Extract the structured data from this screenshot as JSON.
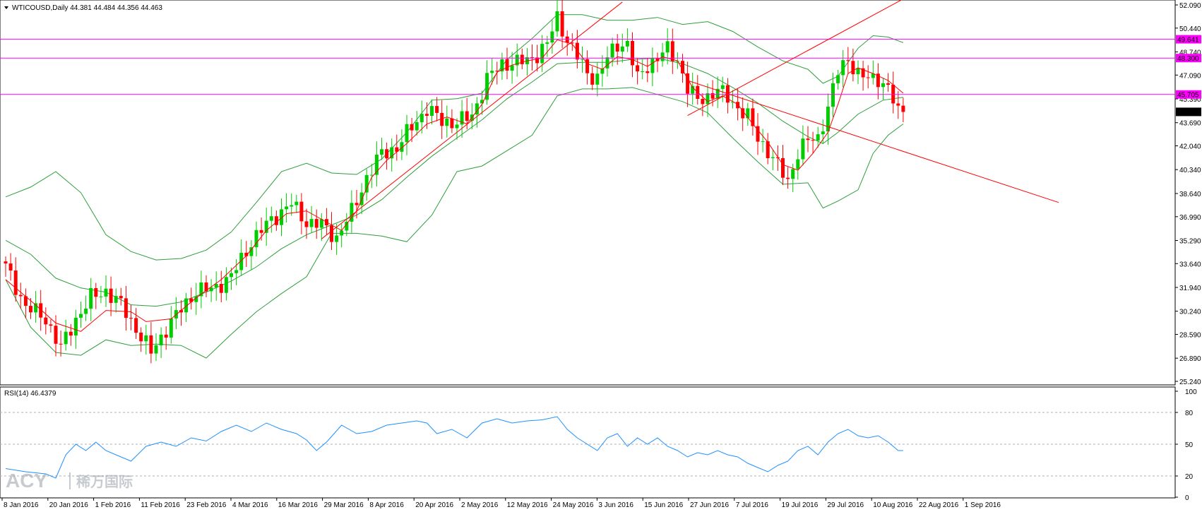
{
  "header": {
    "symbol_line": "WTICOUSD,Daily  44.381 44.484 44.356 44.463",
    "rsi_line": "RSI(14) 46.4379"
  },
  "logo": {
    "brand": "ACY",
    "cn": "稀万国际"
  },
  "chart_data": {
    "type": "candlestick",
    "price_axis": {
      "ticks": [
        "52.090",
        "50.440",
        "48.740",
        "47.090",
        "45.390",
        "43.690",
        "42.040",
        "40.340",
        "38.640",
        "36.990",
        "35.290",
        "33.640",
        "31.940",
        "30.240",
        "28.590",
        "26.890",
        "25.240"
      ],
      "ylim": [
        25.24,
        52.09
      ]
    },
    "horizontal_levels": [
      {
        "value": 49.641,
        "label": "49.641",
        "color": "#ff00ff"
      },
      {
        "value": 48.3,
        "label": "48.300",
        "color": "#ff00ff"
      },
      {
        "value": 45.705,
        "label": "45.705",
        "color": "#ff00ff"
      }
    ],
    "current_price": "44.463",
    "date_labels": [
      "8 Jan 2016",
      "20 Jan 2016",
      "1 Feb 2016",
      "11 Feb 2016",
      "23 Feb 2016",
      "4 Mar 2016",
      "16 Mar 2016",
      "29 Mar 2016",
      "8 Apr 2016",
      "20 Apr 2016",
      "2 May 2016",
      "12 May 2016",
      "24 May 2016",
      "3 Jun 2016",
      "15 Jun 2016",
      "27 Jun 2016",
      "7 Jul 2016",
      "19 Jul 2016",
      "29 Jul 2016",
      "10 Aug 2016",
      "22 Aug 2016",
      "1 Sep 2016"
    ],
    "close_path": [
      [
        0,
        33.4
      ],
      [
        4,
        30.6
      ],
      [
        8,
        29.7
      ],
      [
        11,
        27.6
      ],
      [
        14,
        29.7
      ],
      [
        17,
        31.2
      ],
      [
        20,
        31.7
      ],
      [
        23,
        30.7
      ],
      [
        26,
        29.0
      ],
      [
        29,
        27.3
      ],
      [
        32,
        29.0
      ],
      [
        35,
        30.4
      ],
      [
        38,
        31.7
      ],
      [
        41,
        31.8
      ],
      [
        45,
        32.7
      ],
      [
        49,
        35.2
      ],
      [
        53,
        36.8
      ],
      [
        57,
        37.9
      ],
      [
        60,
        36.6
      ],
      [
        63,
        36.4
      ],
      [
        66,
        35.5
      ],
      [
        69,
        37.3
      ],
      [
        72,
        39.8
      ],
      [
        75,
        41.5
      ],
      [
        78,
        41.9
      ],
      [
        81,
        43.4
      ],
      [
        84,
        44.7
      ],
      [
        87,
        43.8
      ],
      [
        90,
        43.7
      ],
      [
        93,
        44.2
      ],
      [
        96,
        46.8
      ],
      [
        99,
        47.9
      ],
      [
        102,
        48.0
      ],
      [
        104,
        48.1
      ],
      [
        106,
        48.6
      ],
      [
        108,
        49.3
      ],
      [
        110,
        51.2
      ],
      [
        112,
        49.6
      ],
      [
        114,
        48.4
      ],
      [
        116,
        47.2
      ],
      [
        118,
        46.9
      ],
      [
        120,
        48.3
      ],
      [
        122,
        49.3
      ],
      [
        124,
        49.3
      ],
      [
        126,
        46.8
      ],
      [
        128,
        47.8
      ],
      [
        130,
        48.3
      ],
      [
        132,
        48.9
      ],
      [
        134,
        48.2
      ],
      [
        136,
        46.1
      ],
      [
        138,
        45.3
      ],
      [
        140,
        45.6
      ],
      [
        142,
        46.0
      ],
      [
        144,
        45.5
      ],
      [
        146,
        44.8
      ],
      [
        148,
        44.1
      ],
      [
        150,
        42.6
      ],
      [
        152,
        41.7
      ],
      [
        154,
        40.6
      ],
      [
        156,
        39.5
      ],
      [
        158,
        41.6
      ],
      [
        160,
        42.4
      ],
      [
        162,
        42.6
      ],
      [
        164,
        44.8
      ],
      [
        166,
        47.3
      ],
      [
        168,
        48.3
      ],
      [
        170,
        47.1
      ],
      [
        172,
        46.8
      ],
      [
        174,
        46.9
      ],
      [
        176,
        46.1
      ],
      [
        178,
        44.4
      ],
      [
        179,
        44.46
      ]
    ],
    "last_day_index": 179,
    "ma_path": [
      [
        0,
        32.5
      ],
      [
        5,
        31.0
      ],
      [
        10,
        29.4
      ],
      [
        15,
        28.8
      ],
      [
        20,
        30.3
      ],
      [
        25,
        30.2
      ],
      [
        28,
        29.5
      ],
      [
        33,
        29.7
      ],
      [
        38,
        31.2
      ],
      [
        43,
        32.5
      ],
      [
        48,
        34.2
      ],
      [
        52,
        36.0
      ],
      [
        56,
        37.2
      ],
      [
        60,
        37.4
      ],
      [
        64,
        36.6
      ],
      [
        67,
        36.0
      ],
      [
        70,
        37.4
      ],
      [
        73,
        39.8
      ],
      [
        76,
        41.0
      ],
      [
        80,
        42.2
      ],
      [
        84,
        43.6
      ],
      [
        88,
        44.1
      ],
      [
        92,
        43.6
      ],
      [
        95,
        45.0
      ],
      [
        98,
        47.3
      ],
      [
        101,
        47.8
      ],
      [
        104,
        48.1
      ],
      [
        107,
        48.3
      ],
      [
        110,
        49.6
      ],
      [
        113,
        49.3
      ],
      [
        116,
        47.9
      ],
      [
        119,
        47.5
      ],
      [
        122,
        48.4
      ],
      [
        125,
        48.2
      ],
      [
        128,
        47.7
      ],
      [
        131,
        48.4
      ],
      [
        134,
        48.1
      ],
      [
        137,
        46.2
      ],
      [
        140,
        45.2
      ],
      [
        143,
        45.6
      ],
      [
        146,
        45.0
      ],
      [
        149,
        43.6
      ],
      [
        152,
        42.3
      ],
      [
        155,
        40.7
      ],
      [
        158,
        40.3
      ],
      [
        161,
        41.5
      ],
      [
        164,
        43.0
      ],
      [
        166,
        45.0
      ],
      [
        168,
        47.2
      ],
      [
        170,
        47.6
      ],
      [
        173,
        47.2
      ],
      [
        176,
        46.7
      ],
      [
        179,
        45.8
      ]
    ],
    "bollinger_mid": [
      [
        0,
        35.3
      ],
      [
        5,
        34.3
      ],
      [
        10,
        32.6
      ],
      [
        15,
        31.9
      ],
      [
        20,
        31.6
      ],
      [
        25,
        30.7
      ],
      [
        30,
        30.6
      ],
      [
        35,
        30.9
      ],
      [
        40,
        31.6
      ],
      [
        45,
        32.4
      ],
      [
        50,
        33.4
      ],
      [
        55,
        34.7
      ],
      [
        60,
        35.7
      ],
      [
        65,
        36.4
      ],
      [
        70,
        37.1
      ],
      [
        75,
        38.2
      ],
      [
        80,
        39.8
      ],
      [
        85,
        41.3
      ],
      [
        90,
        42.6
      ],
      [
        95,
        43.9
      ],
      [
        100,
        45.4
      ],
      [
        105,
        46.6
      ],
      [
        110,
        47.9
      ],
      [
        115,
        48.0
      ],
      [
        120,
        48.0
      ],
      [
        125,
        48.2
      ],
      [
        130,
        48.3
      ],
      [
        135,
        47.9
      ],
      [
        140,
        47.2
      ],
      [
        145,
        46.2
      ],
      [
        150,
        45.1
      ],
      [
        155,
        43.8
      ],
      [
        160,
        42.7
      ],
      [
        163,
        42.2
      ],
      [
        166,
        43.0
      ],
      [
        170,
        44.3
      ],
      [
        175,
        45.3
      ],
      [
        179,
        45.5
      ]
    ],
    "bollinger_upper": [
      [
        0,
        38.4
      ],
      [
        5,
        39.1
      ],
      [
        10,
        40.2
      ],
      [
        15,
        38.7
      ],
      [
        20,
        35.7
      ],
      [
        25,
        34.5
      ],
      [
        30,
        33.9
      ],
      [
        35,
        34.0
      ],
      [
        40,
        34.6
      ],
      [
        45,
        35.9
      ],
      [
        50,
        38.0
      ],
      [
        55,
        40.2
      ],
      [
        60,
        40.8
      ],
      [
        65,
        40.1
      ],
      [
        70,
        40.0
      ],
      [
        75,
        41.1
      ],
      [
        80,
        43.0
      ],
      [
        85,
        45.3
      ],
      [
        90,
        45.4
      ],
      [
        95,
        45.8
      ],
      [
        100,
        48.2
      ],
      [
        105,
        49.7
      ],
      [
        110,
        51.4
      ],
      [
        115,
        51.4
      ],
      [
        120,
        51.0
      ],
      [
        125,
        51.0
      ],
      [
        130,
        51.2
      ],
      [
        135,
        50.7
      ],
      [
        140,
        50.9
      ],
      [
        145,
        50.2
      ],
      [
        150,
        49.1
      ],
      [
        155,
        48.1
      ],
      [
        160,
        47.5
      ],
      [
        163,
        46.5
      ],
      [
        166,
        47.0
      ],
      [
        170,
        49.0
      ],
      [
        173,
        49.9
      ],
      [
        176,
        49.8
      ],
      [
        179,
        49.4
      ]
    ],
    "bollinger_lower": [
      [
        0,
        32.5
      ],
      [
        5,
        29.1
      ],
      [
        10,
        27.3
      ],
      [
        15,
        27.1
      ],
      [
        20,
        28.2
      ],
      [
        25,
        27.8
      ],
      [
        30,
        27.9
      ],
      [
        35,
        27.8
      ],
      [
        40,
        26.9
      ],
      [
        45,
        28.6
      ],
      [
        50,
        30.2
      ],
      [
        55,
        31.5
      ],
      [
        60,
        32.7
      ],
      [
        65,
        35.8
      ],
      [
        70,
        35.8
      ],
      [
        75,
        35.6
      ],
      [
        80,
        35.2
      ],
      [
        85,
        37.1
      ],
      [
        90,
        40.2
      ],
      [
        95,
        40.6
      ],
      [
        100,
        41.7
      ],
      [
        105,
        42.8
      ],
      [
        110,
        45.6
      ],
      [
        115,
        46.1
      ],
      [
        120,
        46.1
      ],
      [
        125,
        46.2
      ],
      [
        130,
        45.7
      ],
      [
        135,
        45.2
      ],
      [
        140,
        44.4
      ],
      [
        145,
        42.6
      ],
      [
        150,
        40.9
      ],
      [
        155,
        39.3
      ],
      [
        160,
        39.4
      ],
      [
        163,
        37.6
      ],
      [
        166,
        38.1
      ],
      [
        170,
        38.9
      ],
      [
        173,
        41.5
      ],
      [
        176,
        42.8
      ],
      [
        179,
        43.6
      ]
    ],
    "trendlines": [
      {
        "from": [
          63,
          35.4
        ],
        "to": [
          123,
          52.3
        ],
        "color": "#ff0000"
      },
      {
        "from": [
          136,
          44.2
        ],
        "to": [
          182,
          53.1
        ],
        "color": "#ff0000"
      },
      {
        "from": [
          136,
          46.7
        ],
        "to": [
          210,
          38.0
        ],
        "color": "#ff0000"
      }
    ],
    "rsi": {
      "ylim": [
        0,
        100
      ],
      "ticks": [
        "100",
        "80",
        "50",
        "20",
        "0"
      ],
      "levels": [
        80,
        50,
        20
      ],
      "period": 14,
      "value": 46.4379,
      "color": "#1e90ff",
      "path": [
        [
          0,
          27
        ],
        [
          4,
          24
        ],
        [
          8,
          22
        ],
        [
          10,
          18
        ],
        [
          12,
          40
        ],
        [
          14,
          50
        ],
        [
          16,
          44
        ],
        [
          18,
          52
        ],
        [
          20,
          44
        ],
        [
          22,
          40
        ],
        [
          25,
          34
        ],
        [
          28,
          48
        ],
        [
          31,
          52
        ],
        [
          34,
          48
        ],
        [
          37,
          56
        ],
        [
          40,
          53
        ],
        [
          43,
          62
        ],
        [
          46,
          68
        ],
        [
          49,
          62
        ],
        [
          52,
          70
        ],
        [
          55,
          64
        ],
        [
          58,
          60
        ],
        [
          60,
          54
        ],
        [
          62,
          44
        ],
        [
          64,
          52
        ],
        [
          67,
          68
        ],
        [
          70,
          60
        ],
        [
          73,
          62
        ],
        [
          76,
          68
        ],
        [
          79,
          70
        ],
        [
          82,
          72
        ],
        [
          84,
          70
        ],
        [
          86,
          60
        ],
        [
          89,
          64
        ],
        [
          92,
          56
        ],
        [
          95,
          70
        ],
        [
          98,
          74
        ],
        [
          101,
          70
        ],
        [
          104,
          72
        ],
        [
          107,
          73
        ],
        [
          110,
          76
        ],
        [
          112,
          64
        ],
        [
          114,
          56
        ],
        [
          116,
          50
        ],
        [
          118,
          44
        ],
        [
          120,
          56
        ],
        [
          122,
          60
        ],
        [
          124,
          48
        ],
        [
          126,
          56
        ],
        [
          128,
          50
        ],
        [
          130,
          56
        ],
        [
          132,
          48
        ],
        [
          134,
          44
        ],
        [
          136,
          38
        ],
        [
          138,
          42
        ],
        [
          140,
          40
        ],
        [
          142,
          44
        ],
        [
          144,
          40
        ],
        [
          146,
          38
        ],
        [
          148,
          32
        ],
        [
          150,
          28
        ],
        [
          152,
          24
        ],
        [
          154,
          30
        ],
        [
          156,
          34
        ],
        [
          158,
          44
        ],
        [
          160,
          48
        ],
        [
          162,
          40
        ],
        [
          164,
          52
        ],
        [
          166,
          60
        ],
        [
          168,
          64
        ],
        [
          170,
          58
        ],
        [
          172,
          56
        ],
        [
          174,
          58
        ],
        [
          176,
          52
        ],
        [
          178,
          44
        ],
        [
          179,
          44
        ]
      ]
    }
  }
}
